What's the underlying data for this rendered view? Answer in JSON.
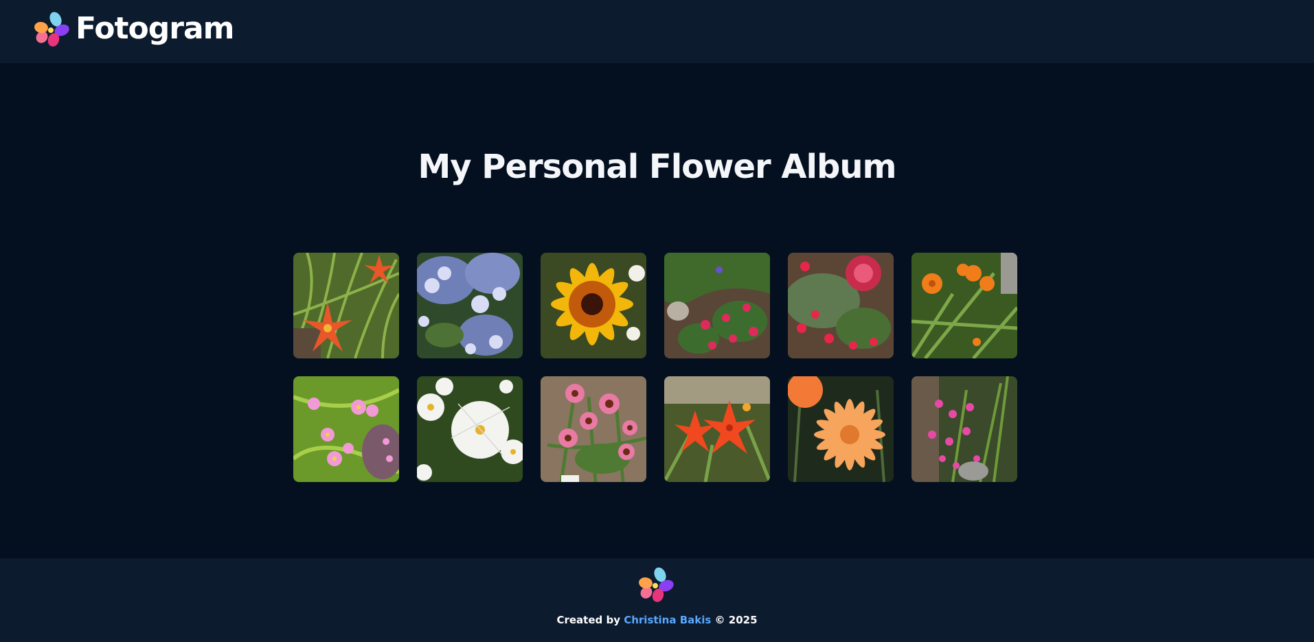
{
  "header": {
    "brand_name": "Fotogram",
    "logo_icon": "petal-logo-icon"
  },
  "main": {
    "title": "My Personal Flower Album",
    "photos": [
      {
        "subject": "orange-daylily-icon"
      },
      {
        "subject": "blue-hydrangea-icon"
      },
      {
        "subject": "yellow-rudbeckia-icon"
      },
      {
        "subject": "pink-zinnia-bed-icon"
      },
      {
        "subject": "red-dahlia-icon"
      },
      {
        "subject": "orange-cosmos-icon"
      },
      {
        "subject": "pink-cosmos-icon"
      },
      {
        "subject": "white-cosmos-icon"
      },
      {
        "subject": "pink-echinacea-icon"
      },
      {
        "subject": "orange-lily-icon"
      },
      {
        "subject": "orange-dahlia-icon"
      },
      {
        "subject": "pink-dianthus-icon"
      }
    ]
  },
  "footer": {
    "created_by": "Created by",
    "author": "Christina Bakis",
    "copyright": "© 2025",
    "logo_icon": "petal-logo-icon"
  },
  "colors": {
    "background": "#040f1f",
    "header_footer": "#0c1b2e",
    "link": "#5aa8ff",
    "text": "#ffffff"
  }
}
